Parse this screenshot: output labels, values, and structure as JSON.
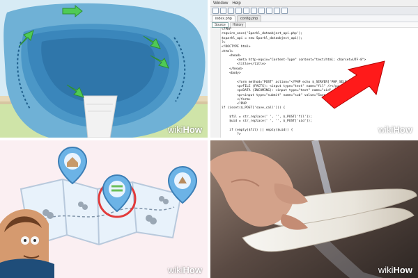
{
  "watermark": {
    "part1": "wiki",
    "part2": "How"
  },
  "editor": {
    "menu": [
      "Window",
      "Help"
    ],
    "tabs": [
      "index.php",
      "config.php"
    ],
    "subtabs": [
      "Source",
      "History"
    ],
    "code_lines": [
      "<?PHP",
      "require_once('Sparkl_dataobject_api.php');",
      "$sparkl_api = new Sparkl_dataobject_api();",
      "?>",
      "<!DOCTYPE html>",
      "<html>",
      "    <head>",
      "        <meta http-equiv=\"Content-Type\" content=\"text/html; charset=UTF-8\">",
      "        <title></title>",
      "    </head>",
      "    <body>",
      "",
      "        <form method=\"POST\" action=\"<?PHP echo $_SERVER['PHP_SELF'] ?>\">",
      "        <p>FILE (FACTS): <input type=\"text\" name=\"fil\" /></p>",
      "        <p>DATA (INCOMING): <input type=\"text\" name=\"uid\" /></p>",
      "        <p><input type=\"submit\" name=\"sub\" value=\"Save call\" /></p>",
      "        </form>",
      "        <?PHP",
      "if (isset($_POST['save_call'])) {",
      "",
      "    $fil = str_replace(' ', '', $_POST['fil']);",
      "    $uid = str_replace(' ', '', $_POST['uid']);",
      "",
      "    if (empty($fil) || empty($uid)) {",
      "        ?>",
      "",
      "        <p style=\"fieldError\">",
      "",
      "",
      "                <?PHP",
      "                }"
    ]
  }
}
